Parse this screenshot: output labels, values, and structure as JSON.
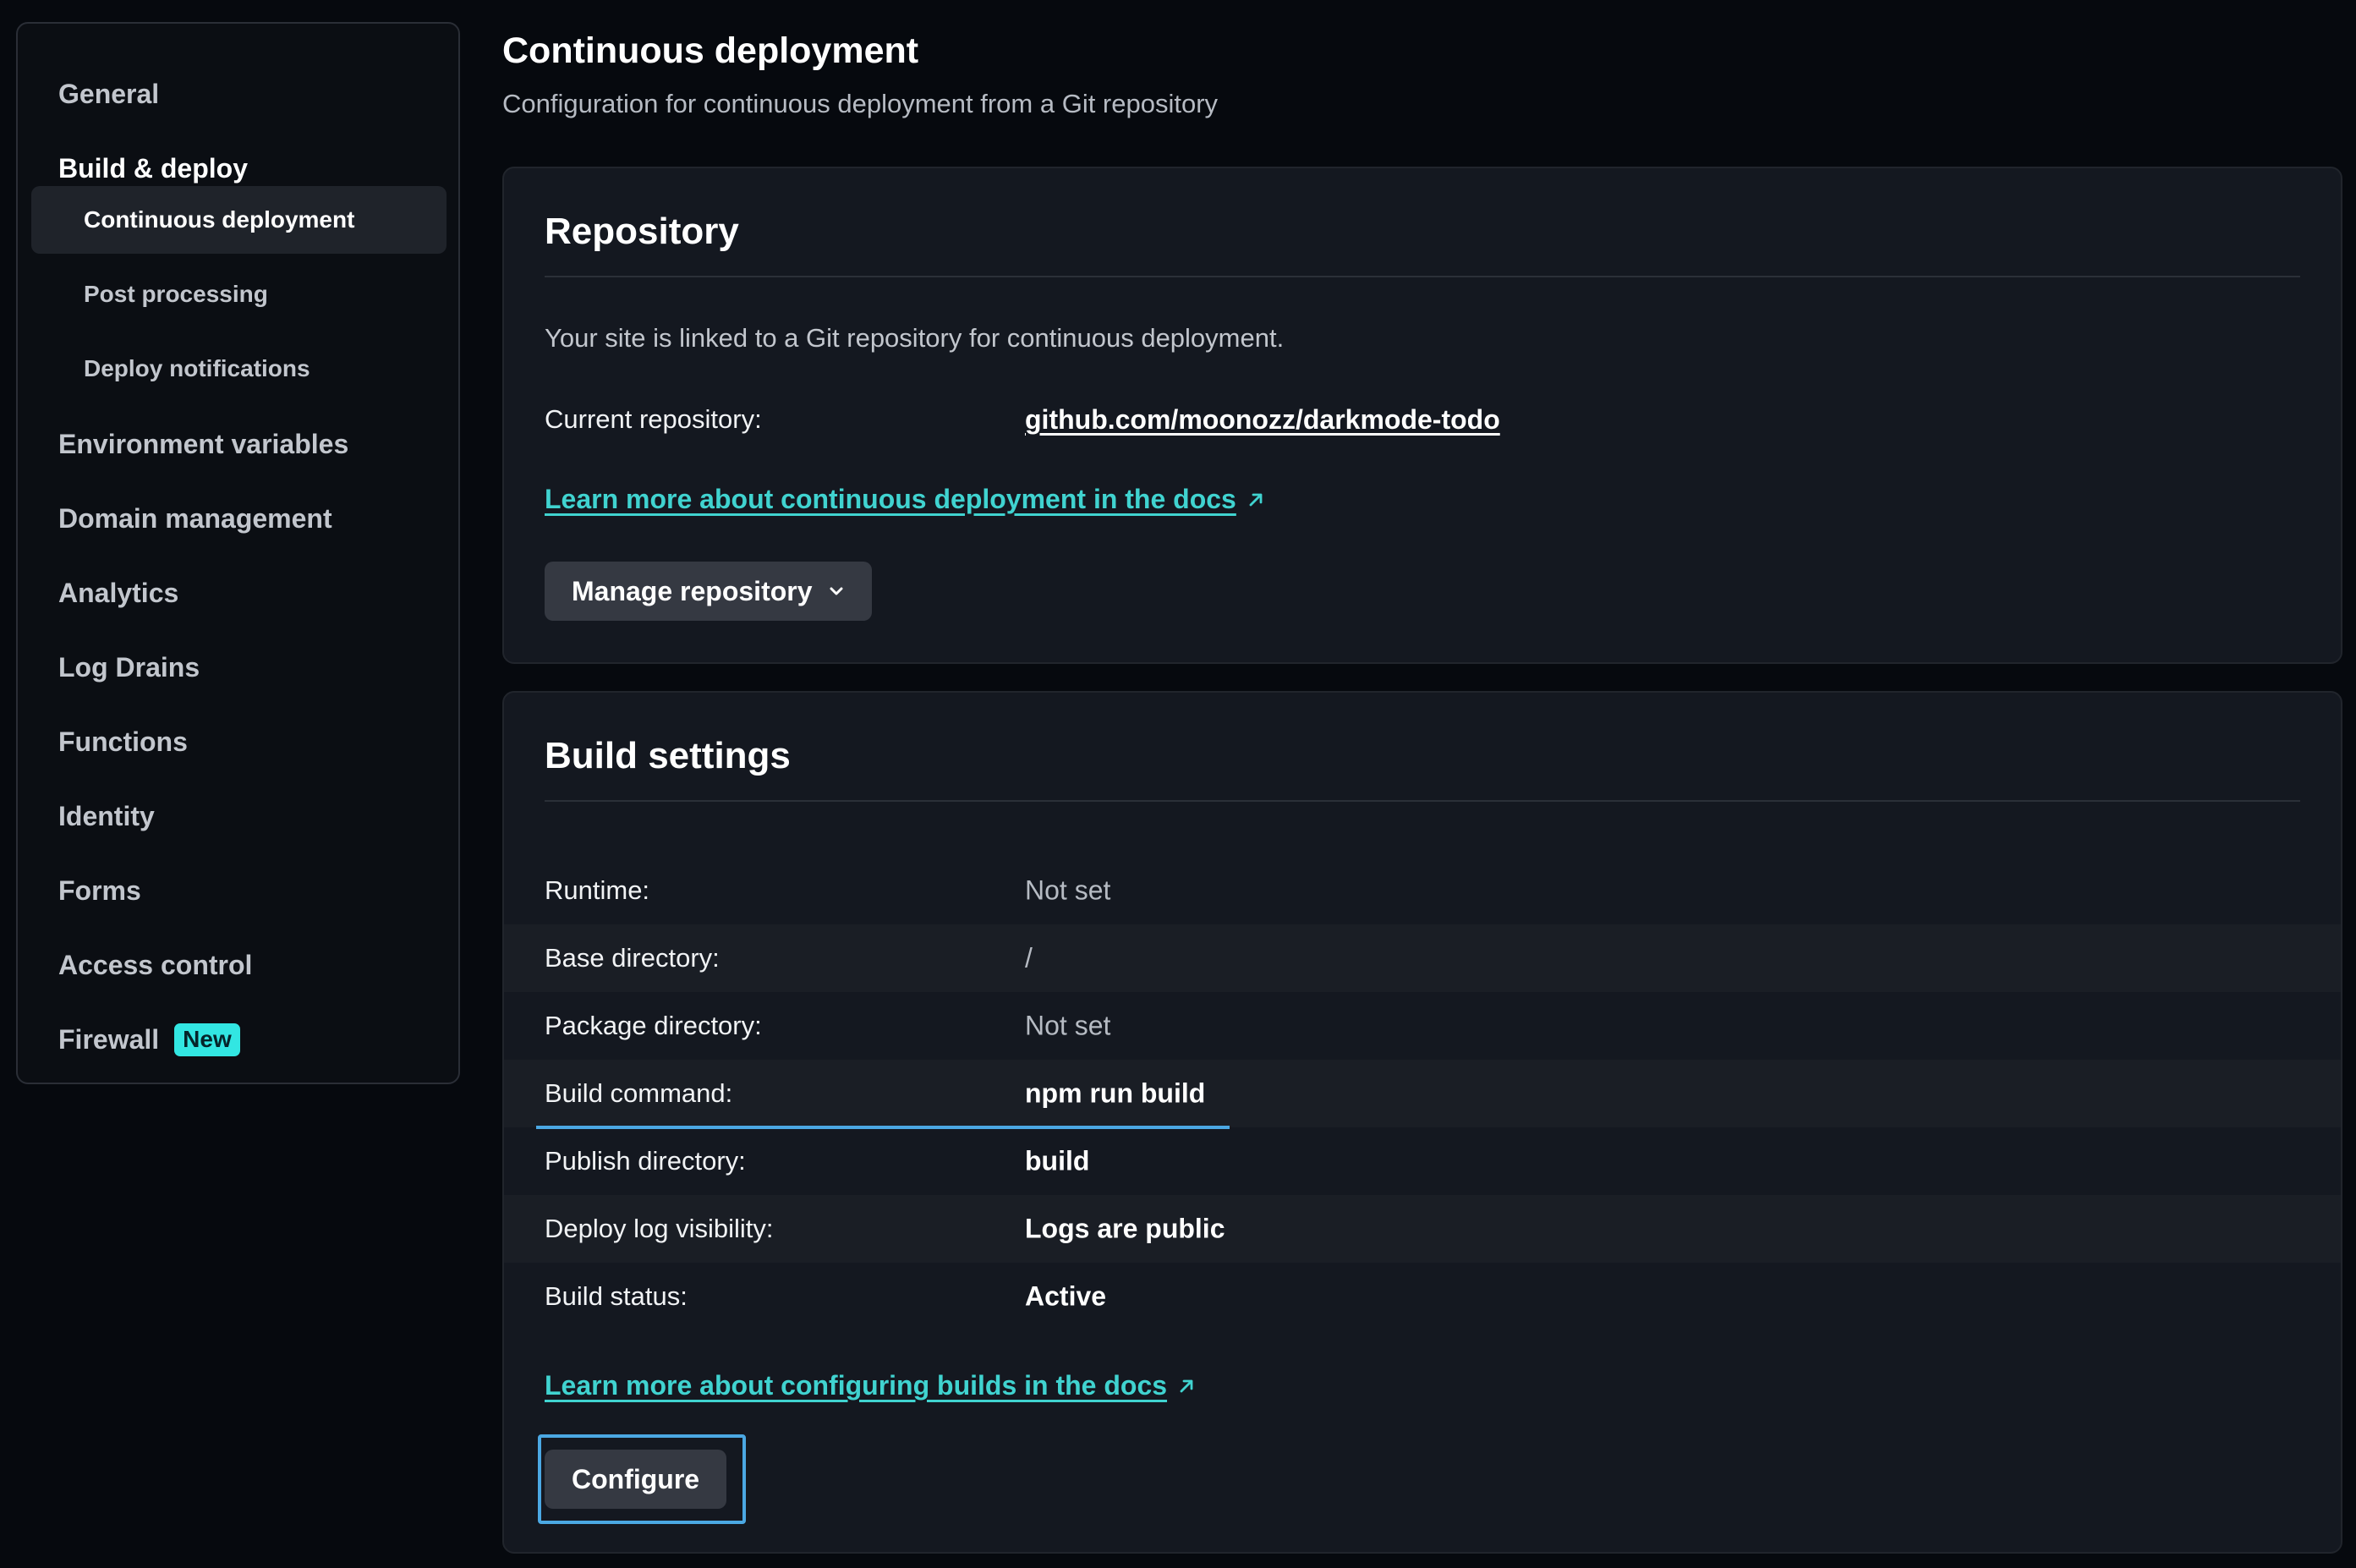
{
  "sidebar": {
    "items": [
      {
        "label": "General"
      },
      {
        "label": "Build & deploy"
      },
      {
        "label": "Continuous deployment"
      },
      {
        "label": "Post processing"
      },
      {
        "label": "Deploy notifications"
      },
      {
        "label": "Environment variables"
      },
      {
        "label": "Domain management"
      },
      {
        "label": "Analytics"
      },
      {
        "label": "Log Drains"
      },
      {
        "label": "Functions"
      },
      {
        "label": "Identity"
      },
      {
        "label": "Forms"
      },
      {
        "label": "Access control"
      },
      {
        "label": "Firewall",
        "badge": "New"
      }
    ],
    "active_item": "Continuous deployment"
  },
  "header": {
    "title": "Continuous deployment",
    "subtitle": "Configuration for continuous deployment from a Git repository"
  },
  "repository": {
    "title": "Repository",
    "description": "Your site is linked to a Git repository for continuous deployment.",
    "current_label": "Current repository:",
    "current_value": "github.com/moonozz/darkmode-todo",
    "docs_link": "Learn more about continuous deployment in the docs",
    "manage_button": "Manage repository"
  },
  "build_settings": {
    "title": "Build settings",
    "rows": [
      {
        "label": "Runtime:",
        "value": "Not set"
      },
      {
        "label": "Base directory:",
        "value": "/"
      },
      {
        "label": "Package directory:",
        "value": "Not set"
      },
      {
        "label": "Build command:",
        "value": "npm run build"
      },
      {
        "label": "Publish directory:",
        "value": "build"
      },
      {
        "label": "Deploy log visibility:",
        "value": "Logs are public"
      },
      {
        "label": "Build status:",
        "value": "Active"
      }
    ],
    "docs_link": "Learn more about configuring builds in the docs",
    "configure_button": "Configure"
  },
  "icons": {
    "external_link": "arrow-up-right-icon",
    "dropdown": "chevron-down-icon"
  },
  "colors": {
    "background": "#06090e",
    "card": "#141820",
    "accent_link": "#40d3d0",
    "focus": "#4ba8e3",
    "badge": "#32e6e2"
  }
}
